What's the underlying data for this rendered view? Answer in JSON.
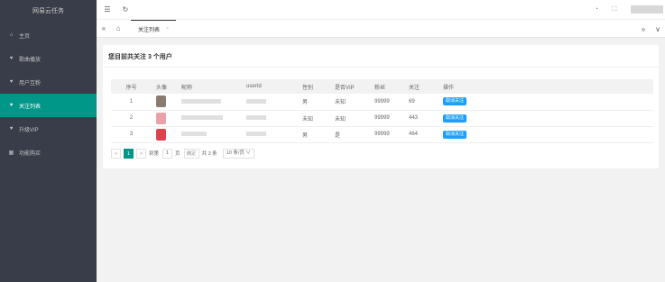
{
  "sidebar": {
    "brand": "网易云任务",
    "items": [
      {
        "icon": "home-icon",
        "glyph": "⌂",
        "label": "主页"
      },
      {
        "icon": "heart-icon",
        "glyph": "♥",
        "label": "歌曲播放"
      },
      {
        "icon": "heart-icon",
        "glyph": "♥",
        "label": "用户互粉"
      },
      {
        "icon": "heart-icon",
        "glyph": "♥",
        "label": "关注列表"
      },
      {
        "icon": "heart-icon",
        "glyph": "♥",
        "label": "升级VIP"
      },
      {
        "icon": "grid-icon",
        "glyph": "▦",
        "label": "功能购买"
      }
    ],
    "active_index": 3
  },
  "header": {
    "menu_glyph": "☰",
    "refresh_glyph": "↻",
    "theme_glyph": "◔",
    "fullscreen_glyph": "⛶"
  },
  "tabs": {
    "prev_glyph": "«",
    "home_glyph": "⌂",
    "items": [
      {
        "label": "关注列表",
        "close": "×"
      }
    ],
    "next_glyph": "»",
    "more_glyph": "∨"
  },
  "card": {
    "title": "您目前共关注 3 个用户"
  },
  "table": {
    "columns": [
      "序号",
      "头像",
      "昵称",
      "userId",
      "性别",
      "是否VIP",
      "粉丝",
      "关注",
      "操作"
    ],
    "rows": [
      {
        "idx": "1",
        "avatar_color": "#8a7a70",
        "sex": "男",
        "vip": "未知",
        "fans": "99999",
        "follow": "69",
        "op": "取消关注"
      },
      {
        "idx": "2",
        "avatar_color": "#e8a3a8",
        "sex": "未知",
        "vip": "未知",
        "fans": "99999",
        "follow": "443",
        "op": "取消关注"
      },
      {
        "idx": "3",
        "avatar_color": "#e0414e",
        "sex": "男",
        "vip": "是",
        "fans": "99999",
        "follow": "464",
        "op": "取消关注"
      }
    ]
  },
  "pager": {
    "prev": "<",
    "current": "1",
    "next": ">",
    "goto_label": "到第",
    "goto_value": "1",
    "page_unit": "页",
    "confirm": "确定",
    "total": "共 3 条",
    "per_page": "10 条/页 ∨"
  },
  "colors": {
    "sidebar_bg": "#393d49",
    "active": "#009688",
    "button": "#1e9fff"
  }
}
